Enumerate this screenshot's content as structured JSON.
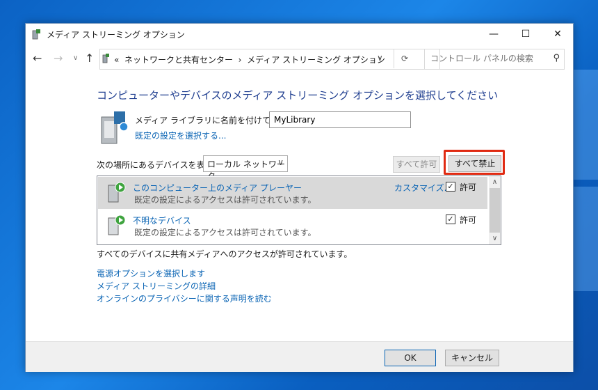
{
  "window": {
    "title": "メディア ストリーミング オプション",
    "controls": {
      "minimize": "—",
      "maximize": "☐",
      "close": "✕"
    }
  },
  "address": {
    "crumb_prefix": "«",
    "crumbs": [
      "ネットワークと共有センター",
      "メディア ストリーミング オプション"
    ],
    "separator": "›"
  },
  "search": {
    "placeholder": "コントロール パネルの検索"
  },
  "page": {
    "heading": "コンピューターやデバイスのメディア ストリーミング オプションを選択してください",
    "library_label": "メディア ライブラリに名前を付けてください:",
    "library_value": "MyLibrary",
    "default_settings_link": "既定の設定を選択する...",
    "show_devices_label": "次の場所にあるデバイスを表示:",
    "location_select": "ローカル ネットワーク",
    "allow_all_button": "すべて許可",
    "block_all_button": "すべて禁止"
  },
  "devices": [
    {
      "name": "このコンピューター上のメディア プレーヤー",
      "desc": "既定の設定によるアクセスは許可されています。",
      "customize": "カスタマイズ...",
      "allow_label": "許可",
      "checked": true,
      "selected": true
    },
    {
      "name": "不明なデバイス",
      "desc": "既定の設定によるアクセスは許可されています。",
      "customize": "",
      "allow_label": "許可",
      "checked": true,
      "selected": false
    }
  ],
  "status_text": "すべてのデバイスに共有メディアへのアクセスが許可されています。",
  "links": [
    "電源オプションを選択します",
    "メディア ストリーミングの詳細",
    "オンラインのプライバシーに関する声明を読む"
  ],
  "footer": {
    "ok": "OK",
    "cancel": "キャンセル"
  },
  "colors": {
    "accent": "#1e3d8f",
    "link": "#0a64b4",
    "highlight": "#e02a12"
  }
}
